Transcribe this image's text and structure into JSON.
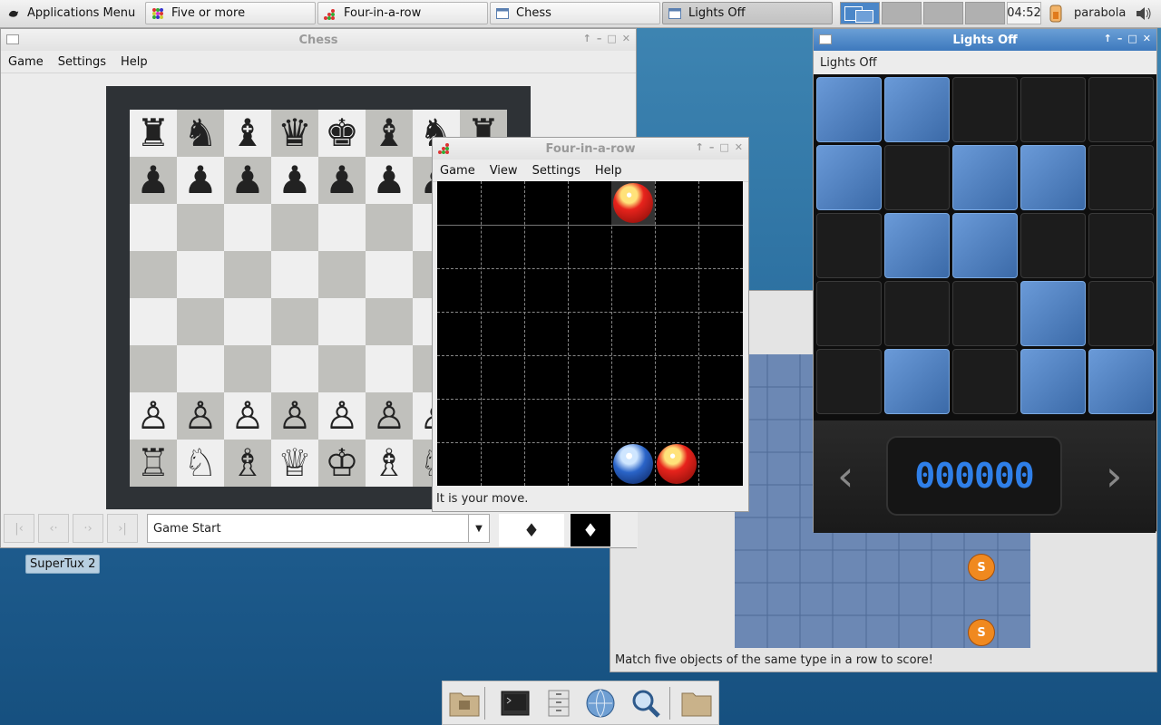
{
  "taskbar": {
    "apps_menu": "Applications Menu",
    "tasks": [
      {
        "label": "Five or more"
      },
      {
        "label": "Four-in-a-row"
      },
      {
        "label": "Chess"
      },
      {
        "label": "Lights Off"
      }
    ],
    "clock": "04:52",
    "user": "parabola"
  },
  "chess": {
    "title": "Chess",
    "menu": [
      "Game",
      "Settings",
      "Help"
    ],
    "position_select": "Game Start",
    "board": [
      [
        "♜",
        "♞",
        "♝",
        "♛",
        "♚",
        "♝",
        "♞",
        "♜"
      ],
      [
        "♟",
        "♟",
        "♟",
        "♟",
        "♟",
        "♟",
        "♟",
        "♟"
      ],
      [
        "",
        "",
        "",
        "",
        "",
        "",
        "",
        ""
      ],
      [
        "",
        "",
        "",
        "",
        "",
        "",
        "",
        ""
      ],
      [
        "",
        "",
        "",
        "",
        "",
        "",
        "",
        ""
      ],
      [
        "",
        "",
        "",
        "",
        "",
        "",
        "",
        ""
      ],
      [
        "♙",
        "♙",
        "♙",
        "♙",
        "♙",
        "♙",
        "♙",
        "♙"
      ],
      [
        "♖",
        "♘",
        "♗",
        "♕",
        "♔",
        "♗",
        "♘",
        "♖"
      ]
    ]
  },
  "four_in_a_row": {
    "title": "Four-in-a-row",
    "menu": [
      "Game",
      "View",
      "Settings",
      "Help"
    ],
    "status": "It is your move."
  },
  "lights_off": {
    "title": "Lights Off",
    "subtitle": "Lights Off",
    "grid": [
      [
        1,
        1,
        0,
        0,
        0
      ],
      [
        1,
        0,
        1,
        1,
        0
      ],
      [
        0,
        1,
        1,
        0,
        0
      ],
      [
        0,
        0,
        0,
        1,
        0
      ],
      [
        0,
        1,
        0,
        1,
        1
      ]
    ],
    "level_display": "000000"
  },
  "five_or_more": {
    "status": "Match five objects of the same type in a row to score!"
  },
  "desktop": {
    "icon_label": "SuperTux 2"
  },
  "colors": {
    "accent_blue": "#3d79bd",
    "lights_on": "#4f7fc2",
    "lcd_digit": "#2f7fe8"
  }
}
